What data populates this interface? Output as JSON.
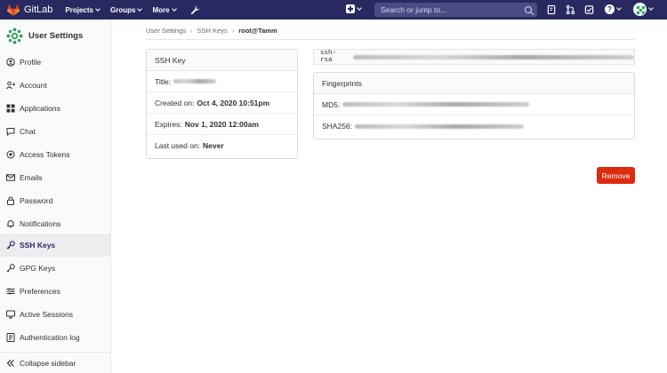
{
  "topbar": {
    "brand": "GitLab",
    "nav": [
      {
        "label": "Projects"
      },
      {
        "label": "Groups"
      },
      {
        "label": "More"
      }
    ],
    "search_placeholder": "Search or jump to...",
    "help_glyph": "?"
  },
  "sidebar": {
    "title": "User Settings",
    "items": [
      {
        "label": "Profile",
        "icon": "profile-icon"
      },
      {
        "label": "Account",
        "icon": "account-icon"
      },
      {
        "label": "Applications",
        "icon": "applications-icon"
      },
      {
        "label": "Chat",
        "icon": "chat-icon"
      },
      {
        "label": "Access Tokens",
        "icon": "token-icon"
      },
      {
        "label": "Emails",
        "icon": "mail-icon"
      },
      {
        "label": "Password",
        "icon": "lock-icon"
      },
      {
        "label": "Notifications",
        "icon": "bell-icon"
      },
      {
        "label": "SSH Keys",
        "icon": "key-icon",
        "active": true
      },
      {
        "label": "GPG Keys",
        "icon": "key-icon"
      },
      {
        "label": "Preferences",
        "icon": "preferences-icon"
      },
      {
        "label": "Active Sessions",
        "icon": "monitor-icon"
      },
      {
        "label": "Authentication log",
        "icon": "log-icon"
      }
    ],
    "collapse_label": "Collapse sidebar"
  },
  "breadcrumb": {
    "items": [
      "User Settings",
      "SSH Keys"
    ],
    "current": "root@Tamm"
  },
  "ssh_key_card": {
    "header": "SSH Key",
    "title_label": "Title:",
    "created_label": "Created on:",
    "created_value": "Oct 4, 2020 10:51pm",
    "expires_label": "Expires:",
    "expires_value": "Nov 1, 2020 12:00am",
    "last_used_label": "Last used on:",
    "last_used_value": "Never"
  },
  "key_content": {
    "prefix": "ssh-rsa"
  },
  "fingerprints": {
    "header": "Fingerprints",
    "md5_label": "MD5:",
    "sha256_label": "SHA256:"
  },
  "actions": {
    "remove_label": "Remove"
  },
  "colors": {
    "topbar": "#292961",
    "danger": "#dd2b0e",
    "brand_orange": "#fc6d26"
  }
}
